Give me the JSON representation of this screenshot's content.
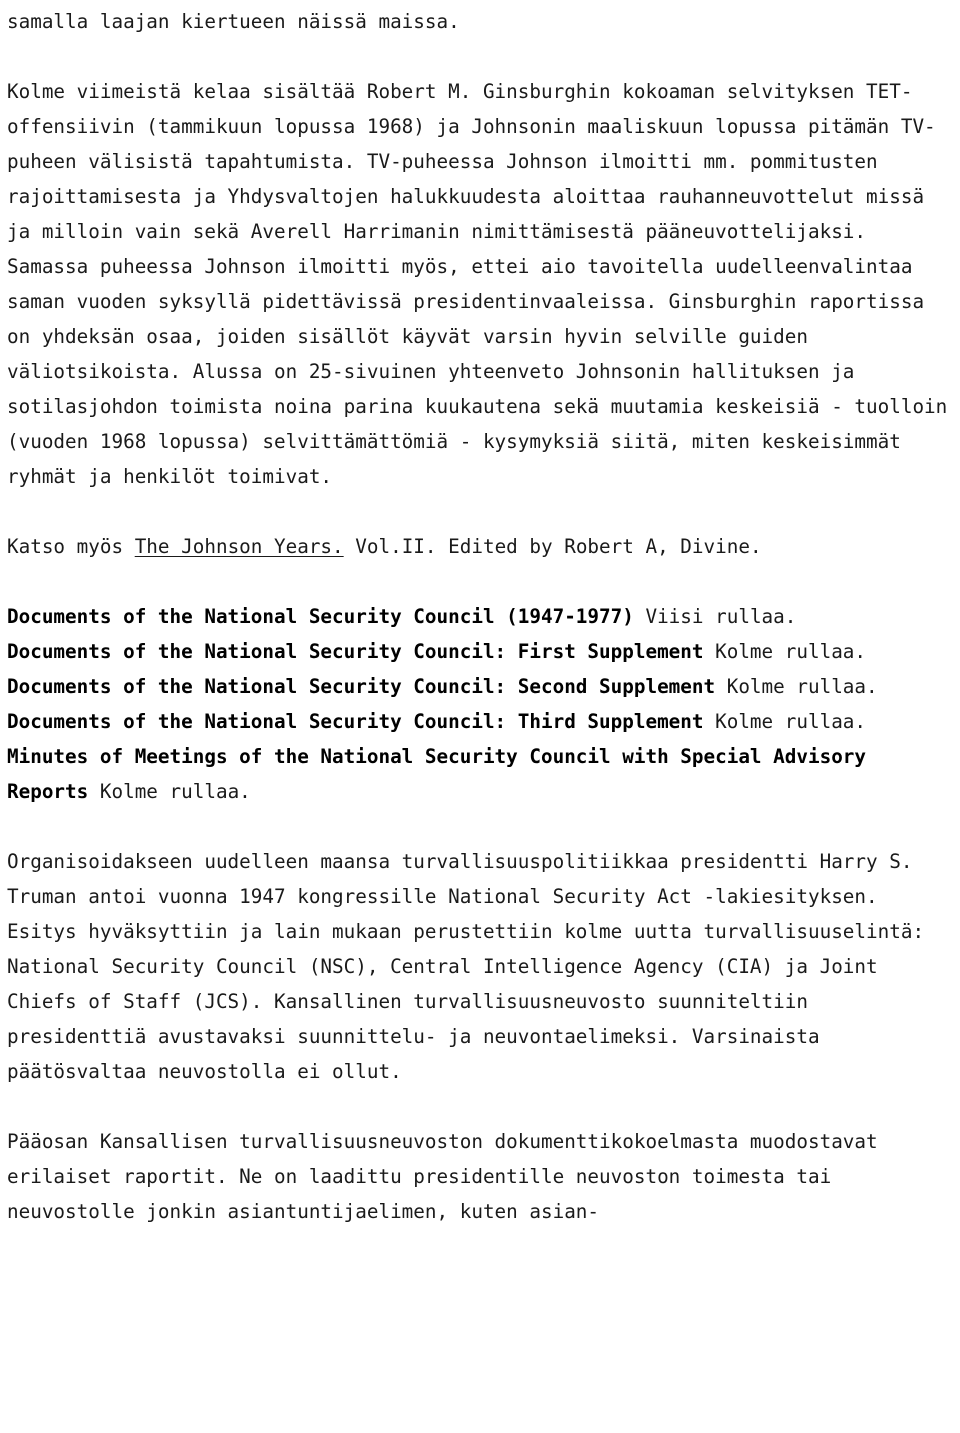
{
  "document": {
    "background_color": "#ffffff",
    "text_color": "#1a1a1a",
    "blocks": [
      {
        "id": "p1",
        "kind": "paragraph",
        "text": "samalla laajan kiertueen näissä maissa."
      },
      {
        "id": "gap1",
        "kind": "blank"
      },
      {
        "id": "p2",
        "kind": "paragraph",
        "text": "Kolme viimeistä kelaa sisältää Robert M. Ginsburghin kokoaman selvityksen TET-offensiivin (tammikuun lopussa 1968) ja Johnsonin maaliskuun lopussa pitämän TV-puheen välisistä tapahtumista. TV-puheessa Johnson ilmoitti mm. pommitusten rajoittamisesta ja Yhdysvaltojen halukkuudesta aloittaa rauhanneuvottelut missä ja milloin vain sekä Averell Harrimanin nimittämisestä pääneuvottelijaksi. Samassa puheessa Johnson ilmoitti myös, ettei aio tavoitella uudelleenvalintaa saman vuoden syksyllä pidettävissä presidentinvaaleissa. Ginsburghin raportissa on yhdeksän osaa, joiden sisällöt käyvät varsin hyvin selville guiden väliotsikoista. Alussa on 25-sivuinen yhteenveto Johnsonin hallituksen ja sotilasjohdon toimista noina parina kuukautena sekä muutamia keskeisiä - tuolloin (vuoden 1968 lopussa) selvittämättömiä - kysymyksiä siitä, miten keskeisimmät ryhmät ja henkilöt toimivat."
      },
      {
        "id": "gap2",
        "kind": "blank"
      },
      {
        "id": "p3",
        "kind": "paragraph-rich",
        "runs": [
          {
            "text": "Katso myös ",
            "style": "plain"
          },
          {
            "text": "The Johnson Years.",
            "style": "underline"
          },
          {
            "text": " Vol.II. Edited by Robert A, Divine.",
            "style": "plain"
          }
        ]
      },
      {
        "id": "gap3",
        "kind": "blank"
      },
      {
        "id": "p4",
        "kind": "paragraph-rich",
        "runs": [
          {
            "text": "Documents of the National Security Council (1947-1977)",
            "style": "bold"
          },
          {
            "text": " Viisi rullaa.",
            "style": "plain"
          }
        ]
      },
      {
        "id": "p5",
        "kind": "paragraph-rich",
        "runs": [
          {
            "text": "Documents of the National Security Council: First Supplement",
            "style": "bold"
          },
          {
            "text": " Kolme rullaa.",
            "style": "plain"
          }
        ]
      },
      {
        "id": "p6",
        "kind": "paragraph-rich",
        "runs": [
          {
            "text": "Documents of the National Security Council: Second Supplement",
            "style": "bold"
          },
          {
            "text": " Kolme rullaa.",
            "style": "plain"
          }
        ]
      },
      {
        "id": "p7",
        "kind": "paragraph-rich",
        "runs": [
          {
            "text": "Documents of the National Security Council: Third Supplement",
            "style": "bold"
          },
          {
            "text": " Kolme rullaa.",
            "style": "plain"
          }
        ]
      },
      {
        "id": "p8",
        "kind": "paragraph-rich",
        "runs": [
          {
            "text": "Minutes of Meetings of the National Security Council with Special Advisory Reports",
            "style": "bold"
          },
          {
            "text": " Kolme rullaa.",
            "style": "plain"
          }
        ]
      },
      {
        "id": "gap4",
        "kind": "blank"
      },
      {
        "id": "p9",
        "kind": "paragraph",
        "text": "Organisoidakseen uudelleen maansa turvallisuuspolitiikkaa presidentti Harry S. Truman antoi vuonna 1947 kongressille National Security Act -lakiesityksen. Esitys hyväksyttiin ja lain mukaan perustettiin kolme uutta turvallisuuselintä: National Security Council (NSC), Central Intelligence Agency (CIA) ja Joint Chiefs of Staff (JCS). Kansallinen turvallisuusneuvosto suunniteltiin presidenttiä avustavaksi suunnittelu- ja neuvontaelimeksi. Varsinaista päätösvaltaa neuvostolla ei ollut."
      },
      {
        "id": "gap5",
        "kind": "blank"
      },
      {
        "id": "p10",
        "kind": "paragraph",
        "text": "Pääosan Kansallisen turvallisuusneuvoston dokumenttikokoelmasta muodostavat erilaiset raportit. Ne on laadittu presidentille neuvoston toimesta tai neuvostolle jonkin asiantuntijaelimen, kuten asian-"
      }
    ]
  }
}
